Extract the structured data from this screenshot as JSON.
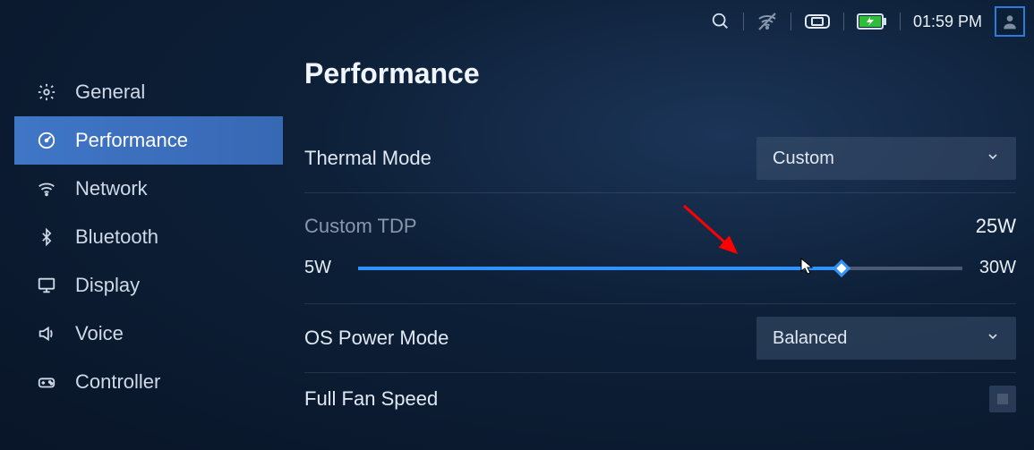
{
  "topbar": {
    "clock": "01:59 PM"
  },
  "sidebar": {
    "items": [
      {
        "label": "General"
      },
      {
        "label": "Performance"
      },
      {
        "label": "Network"
      },
      {
        "label": "Bluetooth"
      },
      {
        "label": "Display"
      },
      {
        "label": "Voice"
      },
      {
        "label": "Controller"
      }
    ],
    "active_index": 1
  },
  "page": {
    "title": "Performance",
    "thermal_mode": {
      "label": "Thermal Mode",
      "value": "Custom"
    },
    "custom_tdp": {
      "label": "Custom TDP",
      "value_label": "25W",
      "min_label": "5W",
      "max_label": "30W",
      "min": 5,
      "max": 30,
      "value": 25
    },
    "os_power_mode": {
      "label": "OS Power Mode",
      "value": "Balanced"
    },
    "full_fan_speed": {
      "label": "Full Fan Speed",
      "checked": false
    }
  },
  "annotation": {
    "arrow_color": "#ff0000"
  }
}
